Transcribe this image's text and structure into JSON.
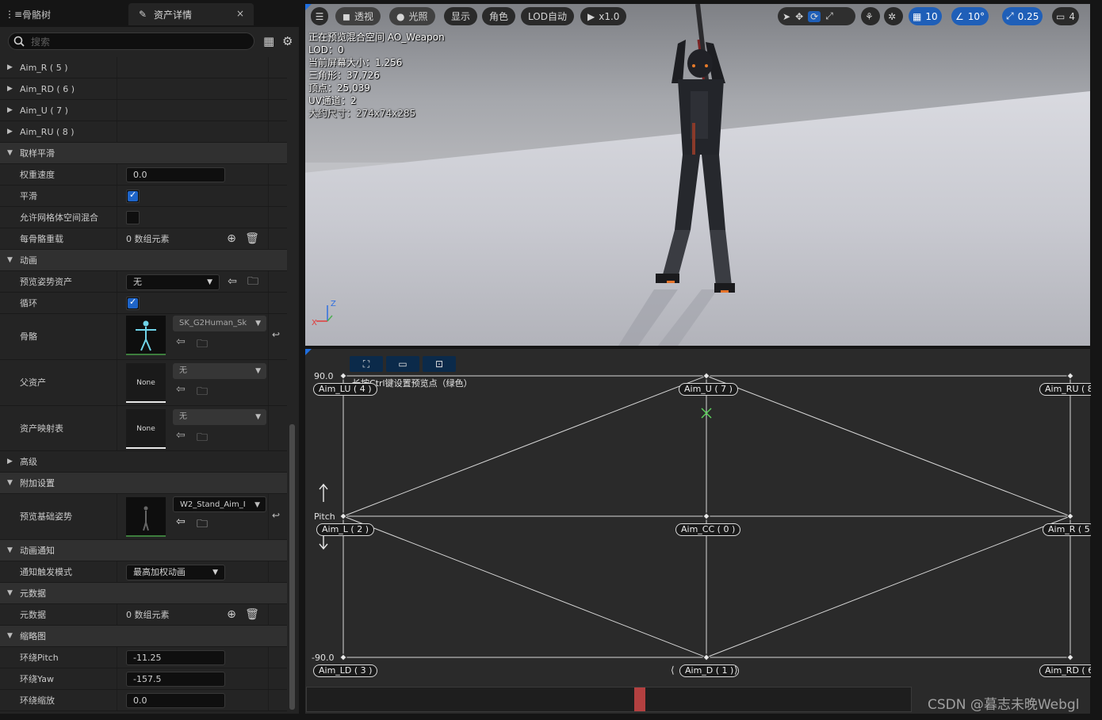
{
  "tabs": {
    "skeleton_tree": "骨骼树",
    "asset_details": "资产详情",
    "close": "×"
  },
  "search": {
    "placeholder": "搜索"
  },
  "rows": {
    "aim_r": "Aim_R ( 5 )",
    "aim_rd": "Aim_RD ( 6 )",
    "aim_u": "Aim_U ( 7 )",
    "aim_ru": "Aim_RU ( 8 )",
    "cat_sample_smoothing": "取样平滑",
    "weight_speed": {
      "label": "权重速度",
      "value": "0.0"
    },
    "smooth": {
      "label": "平滑",
      "checked": true
    },
    "allow_mesh_blend": {
      "label": "允许网格体空间混合",
      "checked": false
    },
    "per_bone_override": {
      "label": "每骨骼重载",
      "value": "0 数组元素"
    },
    "cat_animation": "动画",
    "preview_pose_asset": {
      "label": "预览姿势资产",
      "value": "无"
    },
    "loop": {
      "label": "循环",
      "checked": true
    },
    "skeleton": {
      "label": "骨骼",
      "value": "SK_G2Human_Sk"
    },
    "parent_asset": {
      "label": "父资产",
      "value": "无",
      "thumb": "None"
    },
    "asset_mapping_table": {
      "label": "资产映射表",
      "value": "无",
      "thumb": "None"
    },
    "advanced": "高级",
    "cat_additive": "附加设置",
    "preview_base_pose": {
      "label": "预览基础姿势",
      "value": "W2_Stand_Aim_I"
    },
    "cat_anim_notify": "动画通知",
    "notify_trigger_mode": {
      "label": "通知触发模式",
      "value": "最高加权动画"
    },
    "cat_metadata": "元数据",
    "metadata": {
      "label": "元数据",
      "value": "0 数组元素"
    },
    "cat_thumbnail": "缩略图",
    "orbit_pitch": {
      "label": "环绕Pitch",
      "value": "-11.25"
    },
    "orbit_yaw": {
      "label": "环绕Yaw",
      "value": "-157.5"
    },
    "orbit_zoom": {
      "label": "环绕缩放",
      "value": "0.0"
    }
  },
  "viewport": {
    "toolbar": {
      "perspective": "透视",
      "lit": "光照",
      "show": "显示",
      "character": "角色",
      "lod": "LOD自动",
      "speed": "x1.0",
      "grid_snap": "10",
      "angle_snap": "10°",
      "scale_snap": "0.25",
      "camera_speed": "4"
    },
    "stats": {
      "previewing": "正在预览混合空间 AO_Weapon",
      "lod": "LOD：0",
      "screen_size": "当前屏幕大小：1.256",
      "triangles": "三角形：37,726",
      "vertices": "顶点：25,039",
      "uv_channels": "UV通道：2",
      "approx_size": "大约尺寸：274x74x285"
    }
  },
  "blendspace": {
    "hint": "长按Ctrl键设置预览点（绿色）",
    "axis": {
      "max": "90.0",
      "min": "-90.0",
      "name": "Pitch"
    },
    "points": {
      "lu": "Aim_LU ( 4 )",
      "u": "Aim_U ( 7 )",
      "ru": "Aim_RU ( 8",
      "l": "Aim_L ( 2 )",
      "cc": "Aim_CC ( 0 )",
      "r": "Aim_R ( 5",
      "ld": "Aim_LD ( 3 )",
      "d": "Aim_D ( 1 )",
      "rd": "Aim_RD ( 6"
    }
  },
  "watermark": "CSDN @暮志未晚Webgl",
  "colors": {
    "accent": "#1f5fb8",
    "checkbox": "#1e64c8",
    "playhead": "#b34040",
    "annotation": "#e03a3a"
  }
}
